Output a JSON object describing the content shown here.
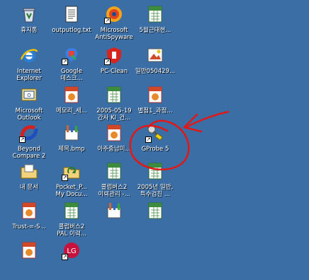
{
  "desktop": {
    "background": "#3a6ea5",
    "annotation_color": "#e01818",
    "icons": [
      {
        "label": "휴지통",
        "icon": "recycle-bin-icon",
        "shortcut": false
      },
      {
        "label": "outputlog.txt",
        "icon": "text-file-icon",
        "shortcut": false
      },
      {
        "label": "Microsoft\nAntiSpyware",
        "icon": "antispyware-icon",
        "shortcut": true
      },
      {
        "label": "5월근태현...",
        "icon": "excel-file-icon",
        "shortcut": false
      },
      {
        "label": "Internet\nExplorer",
        "icon": "internet-explorer-icon",
        "shortcut": false
      },
      {
        "label": "Google\n데스크...",
        "icon": "google-desktop-icon",
        "shortcut": true
      },
      {
        "label": "PC-Clean",
        "icon": "pc-clean-icon",
        "shortcut": true
      },
      {
        "label": "일반050429...",
        "icon": "image-file-icon",
        "shortcut": false
      },
      {
        "label": "Microsoft\nOutlook",
        "icon": "outlook-icon",
        "shortcut": false
      },
      {
        "label": "메모리_세...",
        "icon": "powerpoint-file-icon",
        "shortcut": false
      },
      {
        "label": "2005-05-19\n간사 KI_건...",
        "icon": "excel-file-icon",
        "shortcut": false
      },
      {
        "label": "별첨1_과정...",
        "icon": "powerpoint-file-icon",
        "shortcut": false
      },
      {
        "label": "Beyond\nCompare 2",
        "icon": "beyond-compare-icon",
        "shortcut": true
      },
      {
        "label": "제목.bmp",
        "icon": "paint-bitmap-icon",
        "shortcut": false
      },
      {
        "label": "아주중남미...",
        "icon": "powerpoint-file-icon",
        "shortcut": false
      },
      {
        "label": "GProbe 5",
        "icon": "gprobe-icon",
        "shortcut": true
      },
      {
        "label": "내 문서",
        "icon": "my-documents-icon",
        "shortcut": false
      },
      {
        "label": "Pocket_P...\nMy Docu...",
        "icon": "pocket-pc-folder-icon",
        "shortcut": true
      },
      {
        "label": "콜럼버스2\n이력관리 -...",
        "icon": "excel-file-icon",
        "shortcut": false
      },
      {
        "label": "2005년 일반,\n특수검진 ...",
        "icon": "excel-file-icon",
        "shortcut": false
      },
      {
        "label": "Trust-=-S...",
        "icon": "powerpoint-file-icon",
        "shortcut": false
      },
      {
        "label": "콜럼버스2\nPAL 이력...",
        "icon": "excel-file-icon",
        "shortcut": false
      },
      {
        "label": "",
        "icon": "paint-bitmap-icon",
        "shortcut": false
      },
      {
        "label": "",
        "icon": "excel-file-icon",
        "shortcut": false
      },
      {
        "label": "",
        "icon": "powerpoint-file-icon",
        "shortcut": false
      },
      {
        "label": "",
        "icon": "lg-logo-icon",
        "shortcut": true
      }
    ]
  }
}
